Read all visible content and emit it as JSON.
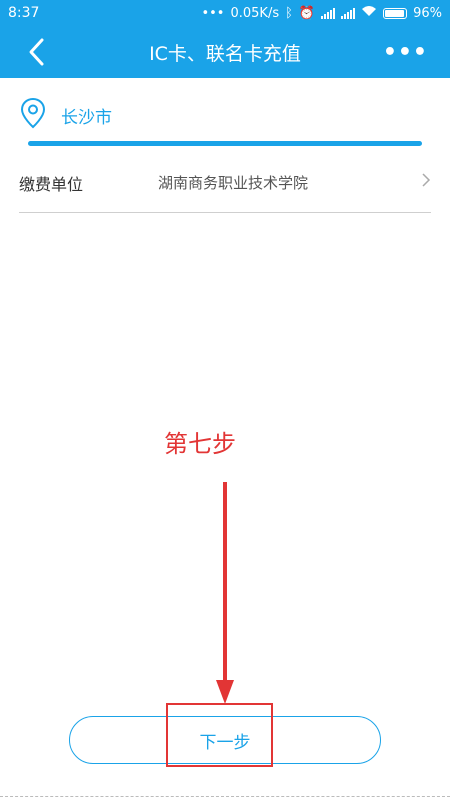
{
  "status_bar": {
    "time": "8:37",
    "network_speed": "0.05K/s",
    "battery_percent": "96%"
  },
  "nav": {
    "title": "IC卡、联名卡充值",
    "more_label": "•••"
  },
  "city": {
    "name": "长沙市"
  },
  "payment_unit": {
    "label": "缴费单位",
    "value": "湖南商务职业技术学院"
  },
  "annotation": {
    "text": "第七步"
  },
  "next_button": {
    "label": "下一步"
  },
  "colors": {
    "accent": "#1aa3e8",
    "annotation_red": "#e23535"
  }
}
